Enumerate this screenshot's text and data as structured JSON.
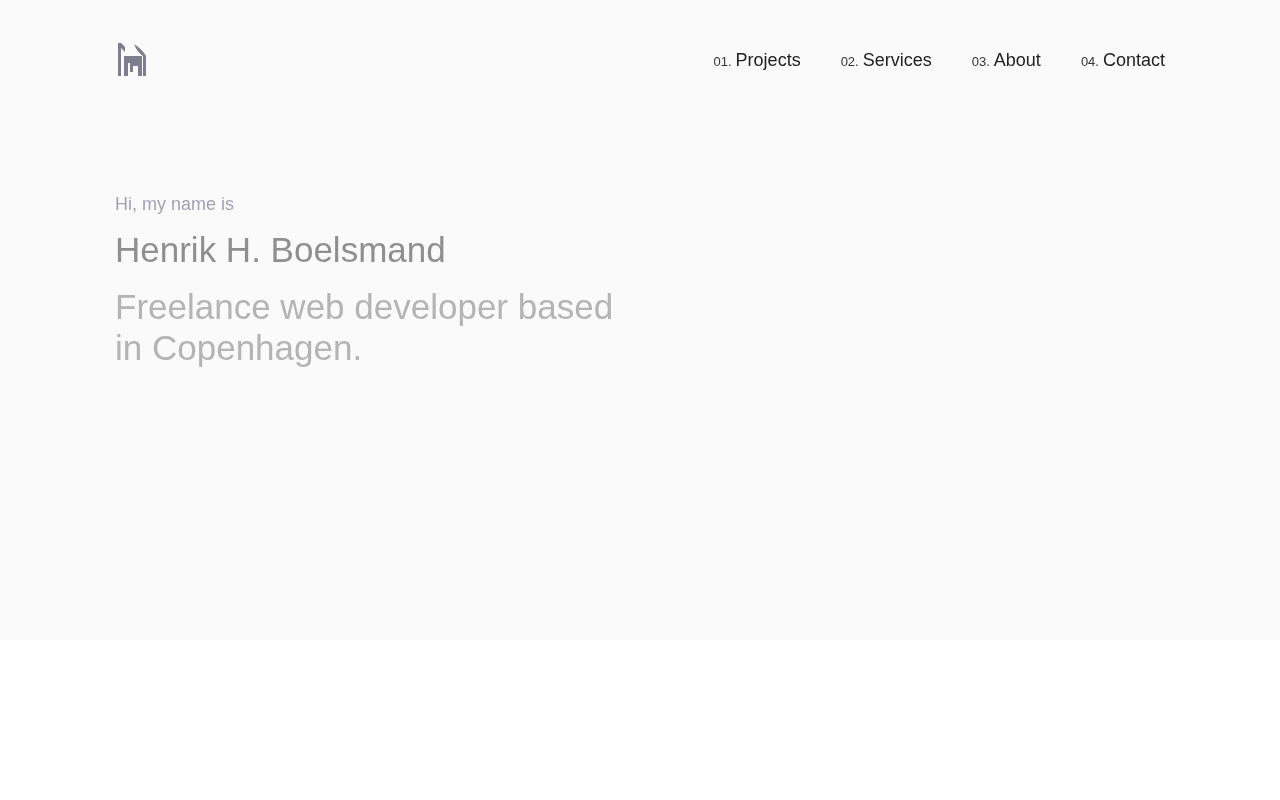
{
  "nav": [
    {
      "number": "01.",
      "label": "Projects"
    },
    {
      "number": "02.",
      "label": "Services"
    },
    {
      "number": "03.",
      "label": "About"
    },
    {
      "number": "04.",
      "label": "Contact"
    }
  ],
  "hero": {
    "greeting": "Hi, my name is",
    "name": "Henrik H. Boelsmand",
    "tagline": "Freelance web developer based in Copenhagen."
  }
}
